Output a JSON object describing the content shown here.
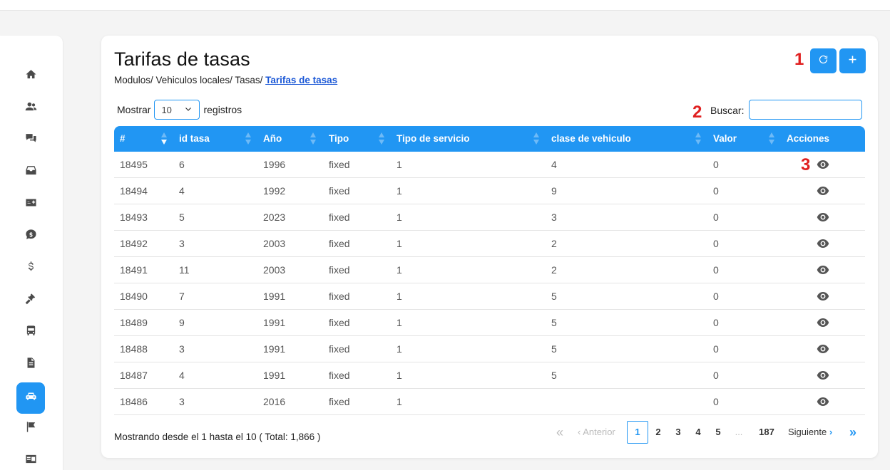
{
  "page": {
    "title": "Tarifas de tasas",
    "breadcrumb_prefix": "Modulos/ Vehiculos locales/ Tasas/ ",
    "breadcrumb_active": "Tarifas de tasas"
  },
  "markers": [
    "1",
    "2",
    "3"
  ],
  "sidebar": {
    "items": [
      {
        "icon": "home-icon"
      },
      {
        "icon": "users-icon"
      },
      {
        "icon": "chat-icon"
      },
      {
        "icon": "inbox-icon"
      },
      {
        "icon": "money-bill-icon"
      },
      {
        "icon": "comment-dollar-icon"
      },
      {
        "icon": "dollar-icon"
      },
      {
        "icon": "gavel-icon"
      },
      {
        "icon": "bus-icon"
      },
      {
        "icon": "document-icon"
      },
      {
        "icon": "car-icon",
        "active": true
      },
      {
        "icon": "flag-icon"
      },
      {
        "icon": "id-card-icon"
      }
    ]
  },
  "controls": {
    "show_label": "Mostrar",
    "page_size": "10",
    "records_label": "registros",
    "search_label": "Buscar:",
    "search_value": ""
  },
  "table": {
    "columns": [
      "#",
      "id tasa",
      "Año",
      "Tipo",
      "Tipo de servicio",
      "clase de vehiculo",
      "Valor",
      "Acciones"
    ],
    "rows": [
      [
        "18495",
        "6",
        "1996",
        "fixed",
        "1",
        "4",
        "0"
      ],
      [
        "18494",
        "4",
        "1992",
        "fixed",
        "1",
        "9",
        "0"
      ],
      [
        "18493",
        "5",
        "2023",
        "fixed",
        "1",
        "3",
        "0"
      ],
      [
        "18492",
        "3",
        "2003",
        "fixed",
        "1",
        "2",
        "0"
      ],
      [
        "18491",
        "11",
        "2003",
        "fixed",
        "1",
        "2",
        "0"
      ],
      [
        "18490",
        "7",
        "1991",
        "fixed",
        "1",
        "5",
        "0"
      ],
      [
        "18489",
        "9",
        "1991",
        "fixed",
        "1",
        "5",
        "0"
      ],
      [
        "18488",
        "3",
        "1991",
        "fixed",
        "1",
        "5",
        "0"
      ],
      [
        "18487",
        "4",
        "1991",
        "fixed",
        "1",
        "5",
        "0"
      ],
      [
        "18486",
        "3",
        "2016",
        "fixed",
        "1",
        "",
        "0"
      ]
    ]
  },
  "footer": {
    "info": "Mostrando desde el 1 hasta el 10 ( Total: 1,866 )"
  },
  "pagination": {
    "first": "«",
    "prev": "Anterior",
    "pages": [
      "1",
      "2",
      "3",
      "4",
      "5"
    ],
    "ellipsis": "...",
    "last_page": "187",
    "next": "Siguiente",
    "last": "»",
    "current": "1"
  },
  "colors": {
    "accent": "#2196f3",
    "marker": "#e02020",
    "link": "#1a57d6"
  }
}
